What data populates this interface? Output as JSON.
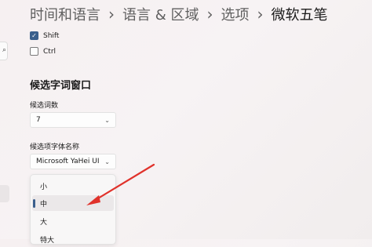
{
  "breadcrumb": {
    "items": [
      "时间和语言",
      "语言 & 区域",
      "选项"
    ],
    "current": "微软五笔",
    "separator": "›"
  },
  "search_icon_glyph": "⌕",
  "checkboxes": [
    {
      "label": "Shift",
      "checked": true
    },
    {
      "label": "Ctrl",
      "checked": false
    }
  ],
  "candidate_window": {
    "title": "候选字词窗口",
    "count_label": "候选词数",
    "count_value": "7",
    "font_label": "候选项字体名称",
    "font_value": "Microsoft YaHei UI",
    "size_options": [
      "小",
      "中",
      "大",
      "特大"
    ],
    "size_selected": "中"
  },
  "check_glyph": "✓",
  "chevron_glyph": "⌄",
  "colors": {
    "accent": "#3a5f8c",
    "arrow": "#e0322b"
  }
}
